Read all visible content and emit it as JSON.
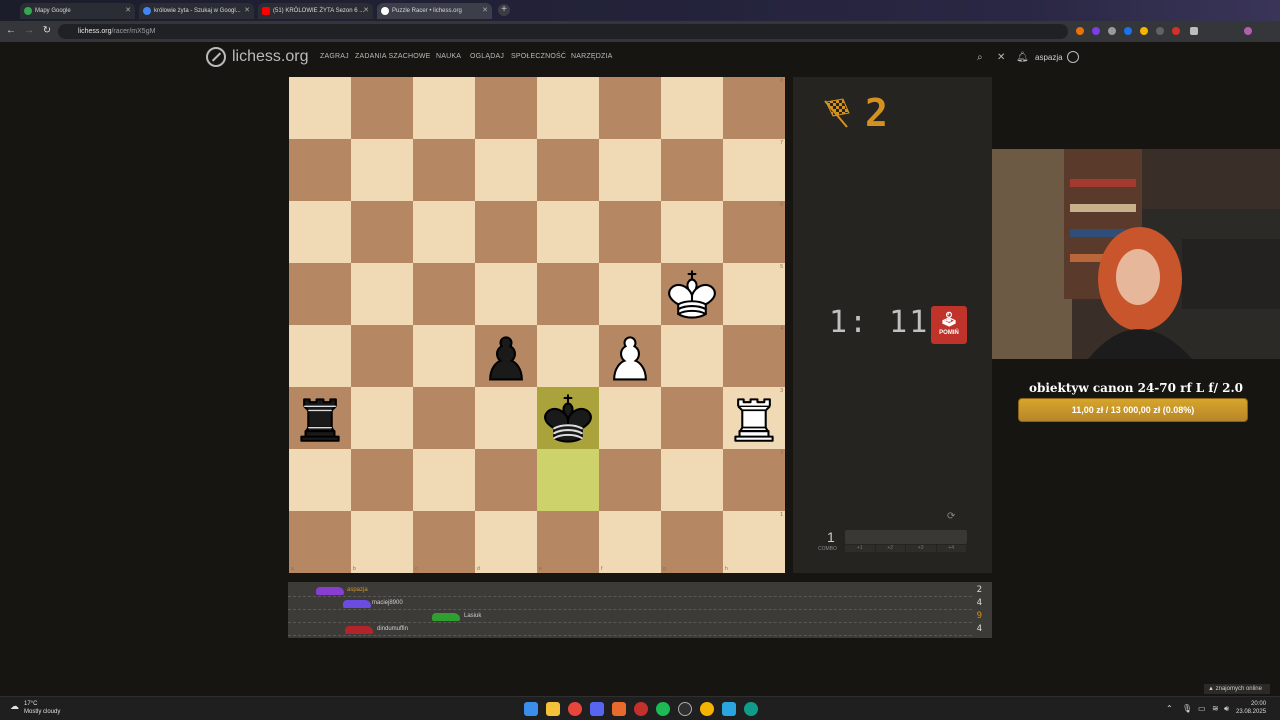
{
  "browser": {
    "tabs": [
      {
        "label": "Mapy Google",
        "color": "#34a853"
      },
      {
        "label": "królowie żyta - Szukaj w Googl...",
        "color": "#4285f4"
      },
      {
        "label": "(51) KRÓLOWIE ŻYTA Sezon 6 ...",
        "color": "#ff0000"
      },
      {
        "label": "Puzzle Racer • lichess.org",
        "color": "#ffffff"
      }
    ],
    "new_tab": "+",
    "url_host": "lichess.org",
    "url_path": "/racer/mX5gM"
  },
  "lichess": {
    "brand": "lichess.org",
    "menu": [
      "ZAGRAJ",
      "ZADANIA SZACHOWE",
      "NAUKA",
      "OGLĄDAJ",
      "SPOŁECZNOŚĆ",
      "NARZĘDZIA"
    ],
    "username": "aspazja"
  },
  "board": {
    "ranks": [
      "8",
      "7",
      "6",
      "5",
      "4",
      "3",
      "2",
      "1"
    ],
    "files": [
      "a",
      "b",
      "c",
      "d",
      "e",
      "f",
      "g",
      "h"
    ],
    "pieces": [
      {
        "square": "g5",
        "type": "king",
        "color": "white"
      },
      {
        "square": "d4",
        "type": "pawn",
        "color": "black"
      },
      {
        "square": "f4",
        "type": "pawn",
        "color": "white"
      },
      {
        "square": "a3",
        "type": "rook",
        "color": "black"
      },
      {
        "square": "e3",
        "type": "king",
        "color": "black"
      },
      {
        "square": "h3",
        "type": "rook",
        "color": "white"
      }
    ],
    "highlight": [
      "e3",
      "e2"
    ]
  },
  "racer": {
    "score": "2",
    "clock": "1: 11",
    "skip_label": "POMIŃ",
    "combo_value": "1",
    "combo_label": "COMBO",
    "combo_steps": [
      "+1",
      "+2",
      "+3",
      "+4"
    ],
    "players": [
      {
        "name": "aspazja",
        "score": "2",
        "car_color": "#8a3dd1",
        "name_color": "#d59120"
      },
      {
        "name": "maciej8900",
        "score": "4",
        "car_color": "#6a4de0",
        "name_color": "#d0d0d0"
      },
      {
        "name": "Lasiuk",
        "score": "9",
        "car_color": "#2fa02f",
        "name_color": "#d0d0d0"
      },
      {
        "name": "dindumuffin",
        "score": "4",
        "car_color": "#b3232a",
        "name_color": "#d0d0d0"
      }
    ]
  },
  "stream": {
    "goal_title": "obiektyw canon 24-70 rf L f/ 2.0",
    "goal_progress_text": "11,00 zł  /  13 000,00 zł  (0.08%)",
    "goal_progress_fraction": 0.0008,
    "friends_online": "znajomych online"
  },
  "taskbar": {
    "temperature": "17°C",
    "weather": "Mostly cloudy",
    "time": "20:00",
    "date": "23.08.2025"
  }
}
